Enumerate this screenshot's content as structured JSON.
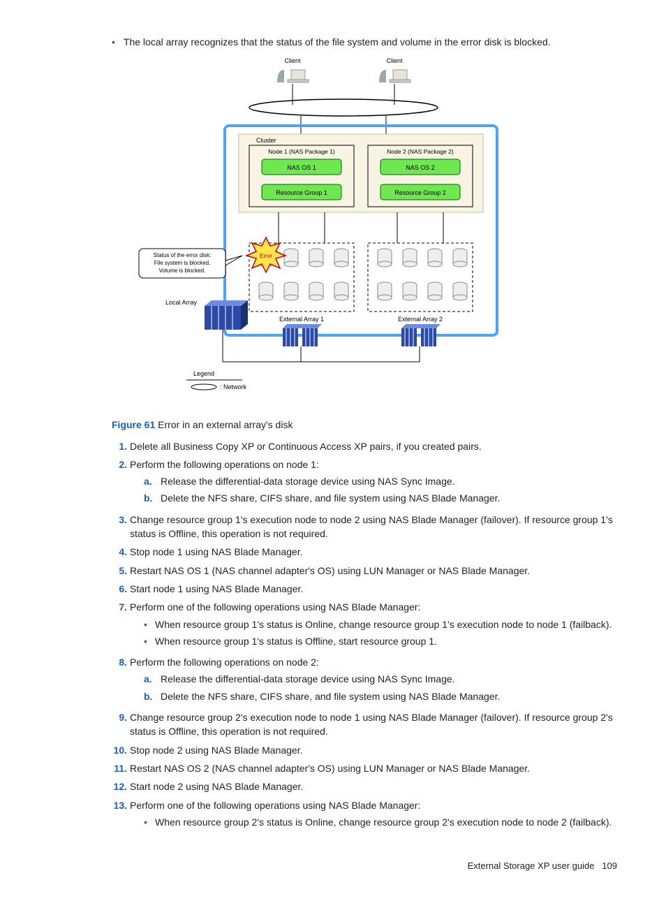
{
  "intro_bullet": "The local array recognizes that the status of the file system and volume in the error disk is blocked.",
  "diagram": {
    "client": "Client",
    "cluster": "Cluster",
    "node1": "Node 1 (NAS Package 1)",
    "node2": "Node 2 (NAS Package 2)",
    "nasos1": "NAS OS 1",
    "nasos2": "NAS OS 2",
    "rg1": "Resource Group 1",
    "rg2": "Resource Group 2",
    "callout_l1": "Status of the error disk:",
    "callout_l2": "File system is blocked.",
    "callout_l3": "Volume is blocked.",
    "error": "Error",
    "local_array": "Local Array",
    "ext1": "External Array 1",
    "ext2": "External Array 2",
    "legend": "Legend",
    "legend_net": ": Network"
  },
  "figure": {
    "label": "Figure 61",
    "caption": "Error in an external array's disk"
  },
  "steps": [
    {
      "n": "1.",
      "text": "Delete all Business Copy XP or Continuous Access XP pairs, if you created pairs."
    },
    {
      "n": "2.",
      "text": "Perform the following operations on node 1:",
      "sub_alpha": [
        {
          "n": "a.",
          "text": "Release the differential-data storage device using NAS Sync Image."
        },
        {
          "n": "b.",
          "text": "Delete the NFS share, CIFS share, and file system using NAS Blade Manager."
        }
      ]
    },
    {
      "n": "3.",
      "text": "Change resource group 1's execution node to node 2 using NAS Blade Manager (failover). If resource group 1's status is Offline, this operation is not required."
    },
    {
      "n": "4.",
      "text": "Stop node 1 using NAS Blade Manager."
    },
    {
      "n": "5.",
      "text": "Restart NAS OS 1 (NAS channel adapter's OS) using LUN Manager or NAS Blade Manager."
    },
    {
      "n": "6.",
      "text": "Start node 1 using NAS Blade Manager."
    },
    {
      "n": "7.",
      "text": "Perform one of the following operations using NAS Blade Manager:",
      "sub_bullet": [
        "When resource group 1's status is Online, change resource group 1's execution node to node 1 (failback).",
        "When resource group 1's status is Offline, start resource group 1."
      ]
    },
    {
      "n": "8.",
      "text": "Perform the following operations on node 2:",
      "sub_alpha": [
        {
          "n": "a.",
          "text": "Release the differential-data storage device using NAS Sync Image."
        },
        {
          "n": "b.",
          "text": "Delete the NFS share, CIFS share, and file system using NAS Blade Manager."
        }
      ]
    },
    {
      "n": "9.",
      "text": "Change resource group 2's execution node to node 1 using NAS Blade Manager (failover). If resource group 2's status is Offline, this operation is not required."
    },
    {
      "n": "10.",
      "text": "Stop node 2 using NAS Blade Manager."
    },
    {
      "n": "11.",
      "text": "Restart NAS OS 2 (NAS channel adapter's OS) using LUN Manager or NAS Blade Manager."
    },
    {
      "n": "12.",
      "text": "Start node 2 using NAS Blade Manager."
    },
    {
      "n": "13.",
      "text": "Perform one of the following operations using NAS Blade Manager:",
      "sub_bullet": [
        "When resource group 2's status is Online, change resource group 2's execution node to node 2 (failback)."
      ]
    }
  ],
  "footer": {
    "title": "External Storage XP user guide",
    "page": "109"
  }
}
